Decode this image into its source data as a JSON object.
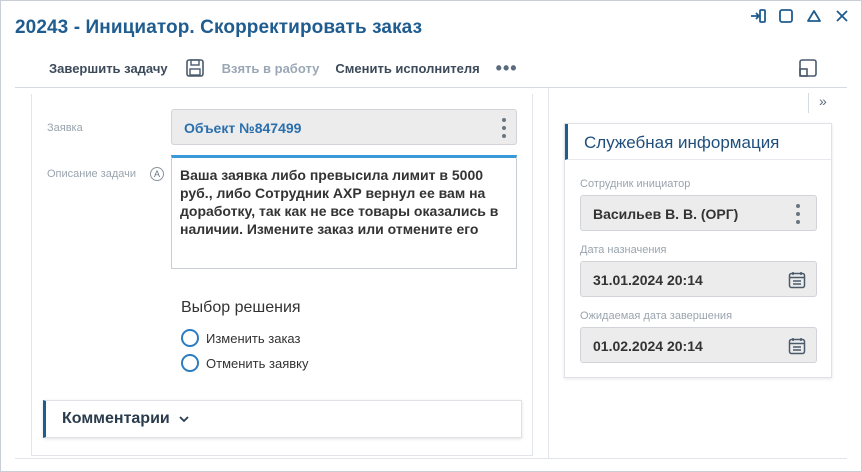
{
  "window": {
    "title": "20243 - Инициатор. Скорректировать заказ"
  },
  "window_controls": [
    "collapse-to-side-icon",
    "maximize-icon",
    "minimize-icon",
    "close-icon"
  ],
  "toolbar": {
    "complete_task": "Завершить задачу",
    "save_icon": "save-icon",
    "take_to_work": "Взять в работу",
    "change_executor": "Сменить исполнителя",
    "more": "•••"
  },
  "form": {
    "request_label": "Заявка",
    "request_value": "Объект №847499",
    "description_label": "Описание задачи",
    "description_text": "Ваша заявка либо превысила лимит в 5000 руб., либо Сотрудник АХР вернул ее вам на доработку, так как не все товары оказались в наличии. Измените заказ или отмените его",
    "decision_title": "Выбор решения",
    "options": [
      {
        "label": "Изменить заказ",
        "selected": false
      },
      {
        "label": "Отменить заявку",
        "selected": false
      }
    ],
    "comments_label": "Комментарии"
  },
  "side_panel": {
    "expand_icon": "»",
    "title": "Служебная информация",
    "initiator_label": "Сотрудник инициатор",
    "initiator_value": "Васильев В. В. (ОРГ)",
    "assigned_date_label": "Дата назначения",
    "assigned_date_value": "31.01.2024 20:14",
    "expected_date_label": "Ожидаемая дата завершения",
    "expected_date_value": "01.02.2024 20:14"
  },
  "colors": {
    "accent": "#1f5c8f",
    "link": "#2a6fad",
    "focus": "#3a9ad9"
  }
}
